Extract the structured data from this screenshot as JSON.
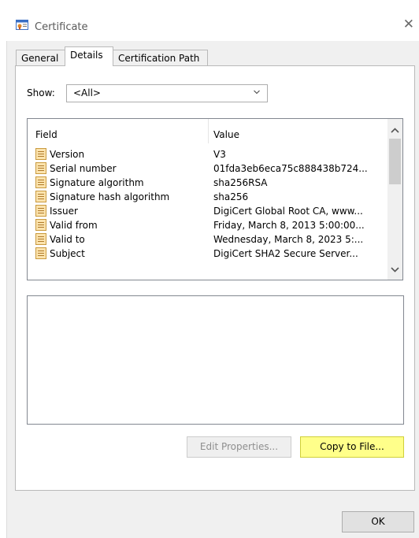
{
  "window": {
    "title": "Certificate"
  },
  "tabs": [
    {
      "label": "General"
    },
    {
      "label": "Details"
    },
    {
      "label": "Certification Path"
    }
  ],
  "show": {
    "label": "Show:",
    "selected": "<All>"
  },
  "list": {
    "columns": [
      "Field",
      "Value"
    ],
    "rows": [
      {
        "field": "Version",
        "value": "V3"
      },
      {
        "field": "Serial number",
        "value": "01fda3eb6eca75c888438b724..."
      },
      {
        "field": "Signature algorithm",
        "value": "sha256RSA"
      },
      {
        "field": "Signature hash algorithm",
        "value": "sha256"
      },
      {
        "field": "Issuer",
        "value": "DigiCert Global Root CA, www..."
      },
      {
        "field": "Valid from",
        "value": "Friday, March 8, 2013 5:00:00..."
      },
      {
        "field": "Valid to",
        "value": "Wednesday, March 8, 2023 5:..."
      },
      {
        "field": "Subject",
        "value": "DigiCert SHA2 Secure Server..."
      }
    ]
  },
  "buttons": {
    "edit_properties": "Edit Properties...",
    "copy_to_file": "Copy to File...",
    "ok": "OK"
  },
  "colors": {
    "highlight": "#ffff8a"
  }
}
